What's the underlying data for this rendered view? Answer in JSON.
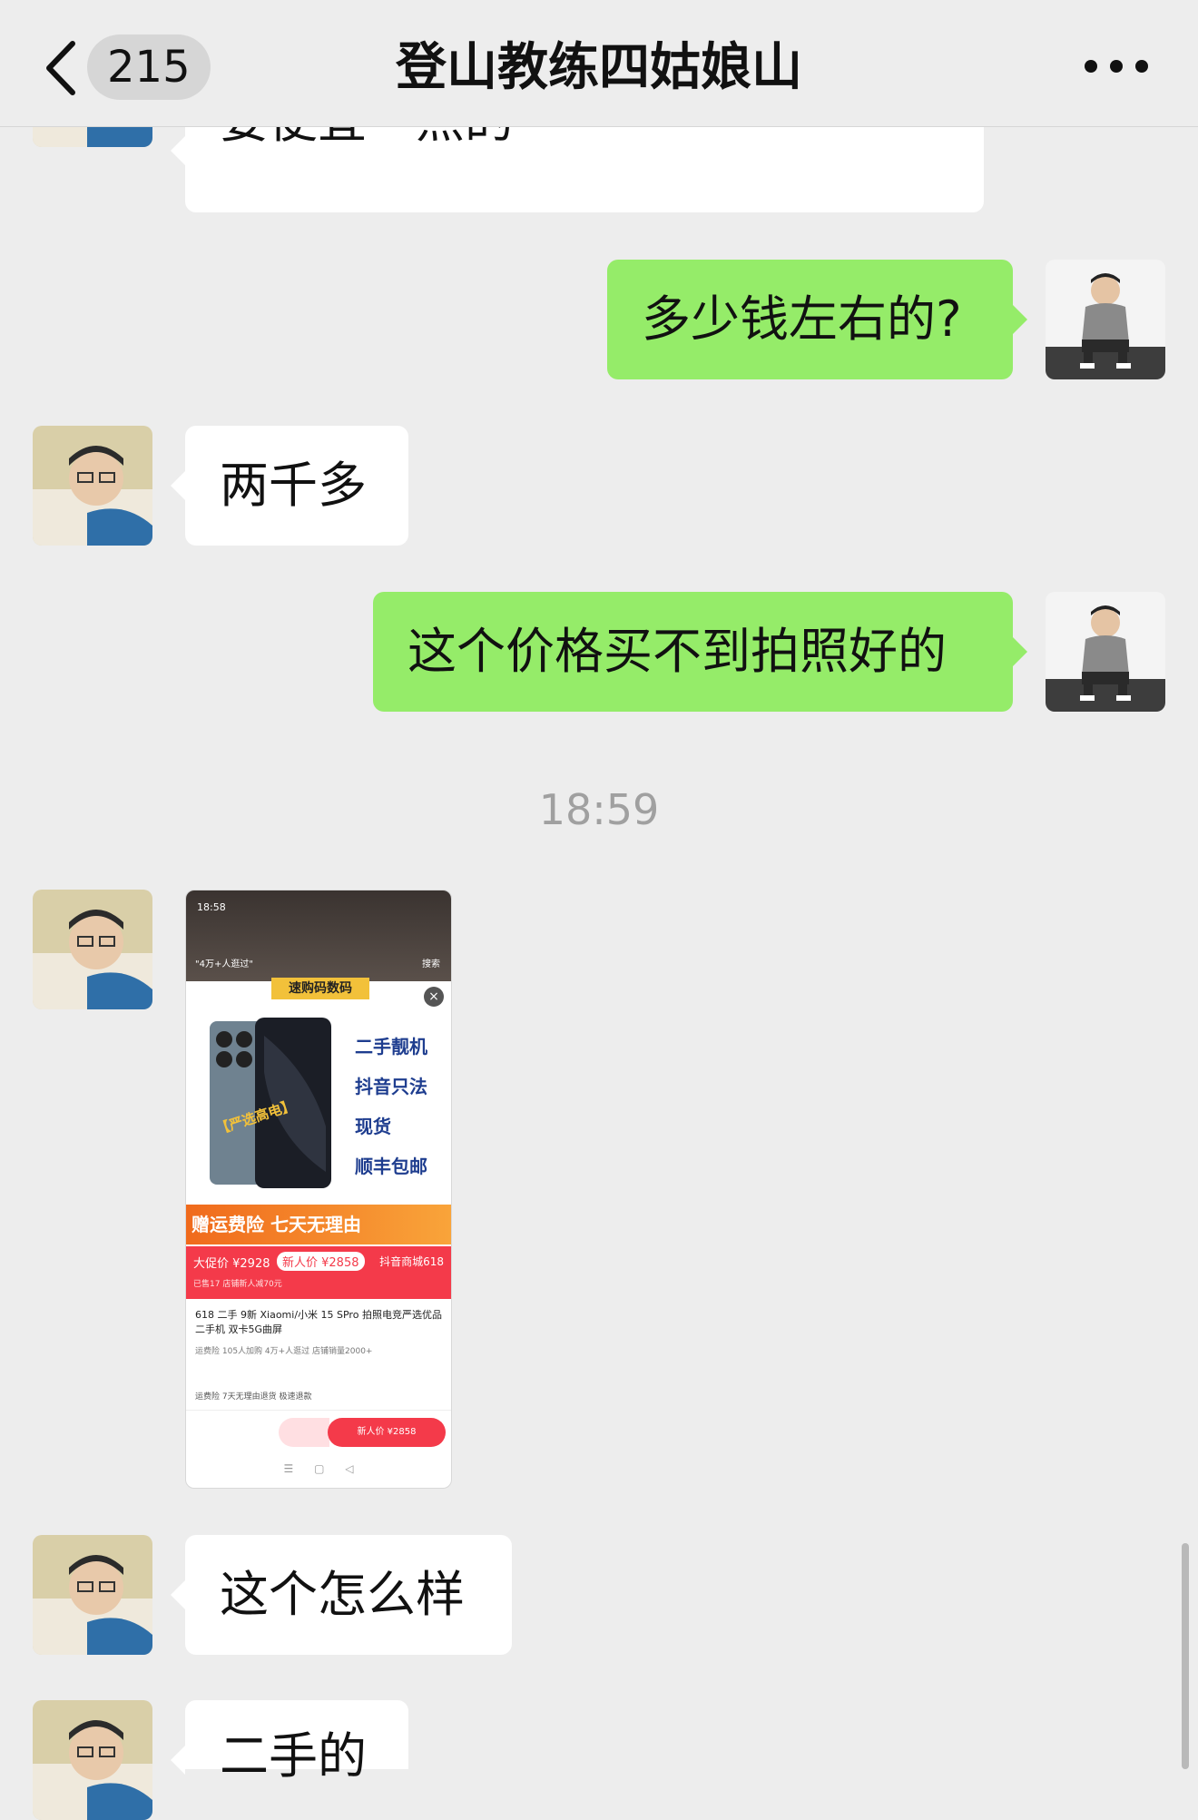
{
  "header": {
    "unread_count": "215",
    "title": "登山教练四姑娘山",
    "back_icon": "chevron-left-icon",
    "more_icon": "more-dots-icon"
  },
  "messages": [
    {
      "side": "left",
      "text": "要便宜一点的"
    },
    {
      "side": "right",
      "text": "多少钱左右的?"
    },
    {
      "side": "left",
      "text": "两千多"
    },
    {
      "side": "right",
      "text": "这个价格买不到拍照好的"
    },
    {
      "side": "left",
      "text": "这个怎么样"
    },
    {
      "side": "left",
      "text": "二手的"
    }
  ],
  "timestamp": "18:59",
  "shared_image": {
    "status_time": "18:58",
    "search_hint": "\"4万+人逛过\"",
    "search_label": "搜索",
    "store_name": "速购码数码",
    "phone_tag": "【严选高电】",
    "tags": [
      "二手靓机",
      "抖音只法",
      "现货",
      "顺丰包邮"
    ],
    "banner": "赠运费险 七天无理由",
    "price_label": "大促价 ¥2928",
    "new_price": "新人价 ¥2858",
    "mall_label": "抖音商城618",
    "price_note": "已售17 店铺新人减70元",
    "product_title": "618 二手 9新 Xiaomi/小米 15 SPro 拍照电竞严选优品二手机 双卡5G曲屏",
    "product_meta": "运费险 105人加购 4万+人逛过 店铺销量2000+",
    "services": "运费险 7天无理由退货 极速退款",
    "buy_button": "新人价 ¥2858"
  },
  "colors": {
    "background": "#ededed",
    "bubble_in": "#ffffff",
    "bubble_out": "#95ec69",
    "timestamp": "#a0a0a0"
  }
}
